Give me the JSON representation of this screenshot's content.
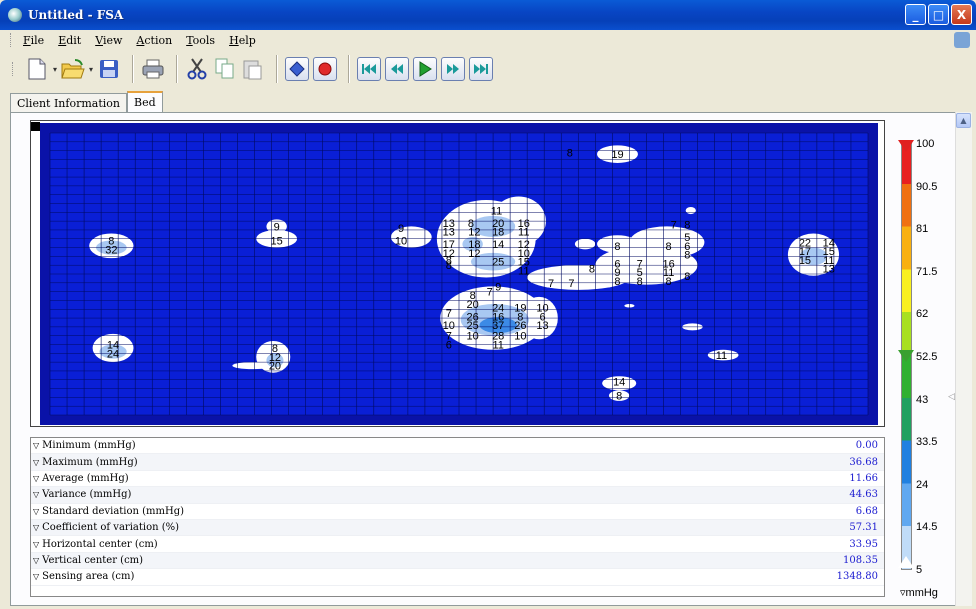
{
  "window": {
    "title": "Untitled - FSA",
    "icon": "app-icon",
    "buttons": {
      "minimize": "_",
      "maximize": "□",
      "close": "X"
    }
  },
  "menu": {
    "items": [
      {
        "label": "File",
        "accel": "F"
      },
      {
        "label": "Edit",
        "accel": "E"
      },
      {
        "label": "View",
        "accel": "V"
      },
      {
        "label": "Action",
        "accel": "A"
      },
      {
        "label": "Tools",
        "accel": "T"
      },
      {
        "label": "Help",
        "accel": "H"
      }
    ]
  },
  "toolbar": {
    "buttons": [
      "new-icon",
      "open-icon",
      "save-icon",
      "print-icon",
      "cut-icon",
      "copy-icon",
      "paste-icon",
      "stop-icon",
      "record-icon",
      "first-frame-icon",
      "previous-frame-icon",
      "play-icon",
      "next-frame-icon",
      "last-frame-icon"
    ]
  },
  "tabs": [
    {
      "label": "Client Information",
      "active": false
    },
    {
      "label": "Bed",
      "active": true
    }
  ],
  "pressure_map": {
    "colors": {
      "background": "#0a1fd6",
      "frame": "#0a12a8",
      "low": "#ffffff",
      "mid": "#a8c8f2",
      "high": "#3c8ae6"
    },
    "rows": 16,
    "cols": 48,
    "labels": [
      {
        "text": "19",
        "r": 1.2,
        "c": 33.3
      },
      {
        "text": "8",
        "r": 1.1,
        "c": 30.5
      },
      {
        "text": "11",
        "r": 4.4,
        "c": 26.2
      },
      {
        "text": "13",
        "r": 5.1,
        "c": 23.4
      },
      {
        "text": "8",
        "r": 5.1,
        "c": 24.7
      },
      {
        "text": "20",
        "r": 5.1,
        "c": 26.3
      },
      {
        "text": "16",
        "r": 5.1,
        "c": 27.8
      },
      {
        "text": "13",
        "r": 5.6,
        "c": 23.4
      },
      {
        "text": "12",
        "r": 5.6,
        "c": 24.9
      },
      {
        "text": "18",
        "r": 5.6,
        "c": 26.3
      },
      {
        "text": "11",
        "r": 5.6,
        "c": 27.8
      },
      {
        "text": "9",
        "r": 5.4,
        "c": 20.6
      },
      {
        "text": "10",
        "r": 6.1,
        "c": 20.6
      },
      {
        "text": "17",
        "r": 6.3,
        "c": 23.4
      },
      {
        "text": "18",
        "r": 6.3,
        "c": 24.9
      },
      {
        "text": "14",
        "r": 6.3,
        "c": 26.3
      },
      {
        "text": "12",
        "r": 6.3,
        "c": 27.8
      },
      {
        "text": "12",
        "r": 6.8,
        "c": 23.4
      },
      {
        "text": "12",
        "r": 6.8,
        "c": 24.9
      },
      {
        "text": "10",
        "r": 6.8,
        "c": 27.8
      },
      {
        "text": "8",
        "r": 7.2,
        "c": 23.4
      },
      {
        "text": "8",
        "r": 7.5,
        "c": 23.4
      },
      {
        "text": "25",
        "r": 7.3,
        "c": 26.3
      },
      {
        "text": "15",
        "r": 7.3,
        "c": 27.8
      },
      {
        "text": "11",
        "r": 7.8,
        "c": 27.8
      },
      {
        "text": "7",
        "r": 5.2,
        "c": 36.6
      },
      {
        "text": "8",
        "r": 5.2,
        "c": 37.4
      },
      {
        "text": "8",
        "r": 6.4,
        "c": 33.3
      },
      {
        "text": "5",
        "r": 5.9,
        "c": 37.4
      },
      {
        "text": "6",
        "r": 6.4,
        "c": 37.4
      },
      {
        "text": "8",
        "r": 6.4,
        "c": 36.3
      },
      {
        "text": "8",
        "r": 6.9,
        "c": 37.4
      },
      {
        "text": "6",
        "r": 7.4,
        "c": 33.3
      },
      {
        "text": "7",
        "r": 7.4,
        "c": 34.6
      },
      {
        "text": "16",
        "r": 7.4,
        "c": 36.3
      },
      {
        "text": "8",
        "r": 7.7,
        "c": 31.8
      },
      {
        "text": "9",
        "r": 7.9,
        "c": 33.3
      },
      {
        "text": "5",
        "r": 7.9,
        "c": 34.6
      },
      {
        "text": "11",
        "r": 7.9,
        "c": 36.3
      },
      {
        "text": "8",
        "r": 8.4,
        "c": 33.3
      },
      {
        "text": "8",
        "r": 8.4,
        "c": 34.6
      },
      {
        "text": "8",
        "r": 8.4,
        "c": 36.3
      },
      {
        "text": "8",
        "r": 8.1,
        "c": 37.4
      },
      {
        "text": "7",
        "r": 8.5,
        "c": 29.4
      },
      {
        "text": "7",
        "r": 8.5,
        "c": 30.6
      },
      {
        "text": "9",
        "r": 8.7,
        "c": 26.3
      },
      {
        "text": "22",
        "r": 6.2,
        "c": 44.3
      },
      {
        "text": "14",
        "r": 6.2,
        "c": 45.7
      },
      {
        "text": "17",
        "r": 6.7,
        "c": 44.3
      },
      {
        "text": "15",
        "r": 6.7,
        "c": 45.7
      },
      {
        "text": "15",
        "r": 7.2,
        "c": 44.3
      },
      {
        "text": "11",
        "r": 7.2,
        "c": 45.7
      },
      {
        "text": "13",
        "r": 7.7,
        "c": 45.7
      },
      {
        "text": "8",
        "r": 6.1,
        "c": 3.6
      },
      {
        "text": "32",
        "r": 6.6,
        "c": 3.6
      },
      {
        "text": "9",
        "r": 5.3,
        "c": 13.3
      },
      {
        "text": "15",
        "r": 6.1,
        "c": 13.3
      },
      {
        "text": "8",
        "r": 9.2,
        "c": 24.8
      },
      {
        "text": "7",
        "r": 9.0,
        "c": 25.8
      },
      {
        "text": "20",
        "r": 9.7,
        "c": 24.8
      },
      {
        "text": "24",
        "r": 9.9,
        "c": 26.3
      },
      {
        "text": "19",
        "r": 9.9,
        "c": 27.6
      },
      {
        "text": "10",
        "r": 9.9,
        "c": 28.9
      },
      {
        "text": "7",
        "r": 10.2,
        "c": 23.4
      },
      {
        "text": "26",
        "r": 10.4,
        "c": 24.8
      },
      {
        "text": "16",
        "r": 10.4,
        "c": 26.3
      },
      {
        "text": "8",
        "r": 10.4,
        "c": 27.6
      },
      {
        "text": "6",
        "r": 10.4,
        "c": 28.9
      },
      {
        "text": "10",
        "r": 10.9,
        "c": 23.4
      },
      {
        "text": "25",
        "r": 10.9,
        "c": 24.8
      },
      {
        "text": "37",
        "r": 10.9,
        "c": 26.3
      },
      {
        "text": "26",
        "r": 10.9,
        "c": 27.6
      },
      {
        "text": "13",
        "r": 10.9,
        "c": 28.9
      },
      {
        "text": "7",
        "r": 11.5,
        "c": 23.4
      },
      {
        "text": "10",
        "r": 11.5,
        "c": 24.8
      },
      {
        "text": "28",
        "r": 11.5,
        "c": 26.3
      },
      {
        "text": "10",
        "r": 11.5,
        "c": 27.6
      },
      {
        "text": "6",
        "r": 12.0,
        "c": 23.4
      },
      {
        "text": "11",
        "r": 12.0,
        "c": 26.3
      },
      {
        "text": "14",
        "r": 12.0,
        "c": 3.7
      },
      {
        "text": "24",
        "r": 12.5,
        "c": 3.7
      },
      {
        "text": "8",
        "r": 12.2,
        "c": 13.2
      },
      {
        "text": "12",
        "r": 12.7,
        "c": 13.2
      },
      {
        "text": "20",
        "r": 13.2,
        "c": 13.2
      },
      {
        "text": "11",
        "r": 12.6,
        "c": 39.4
      },
      {
        "text": "14",
        "r": 14.1,
        "c": 33.4
      },
      {
        "text": "8",
        "r": 14.9,
        "c": 33.4
      }
    ]
  },
  "stats": [
    {
      "label": "Minimum (mmHg)",
      "value": "0.00"
    },
    {
      "label": "Maximum (mmHg)",
      "value": "36.68"
    },
    {
      "label": "Average (mmHg)",
      "value": "11.66"
    },
    {
      "label": "Variance (mmHg)",
      "value": "44.63"
    },
    {
      "label": "Standard deviation (mmHg)",
      "value": "6.68"
    },
    {
      "label": "Coefficient of variation (%)",
      "value": "57.31"
    },
    {
      "label": "Horizontal center (cm)",
      "value": "33.95"
    },
    {
      "label": "Vertical center (cm)",
      "value": "108.35"
    },
    {
      "label": "Sensing area (cm)",
      "value": "1348.80"
    }
  ],
  "legend": {
    "ticks": [
      "100",
      "90.5",
      "81",
      "71.5",
      "62",
      "52.5",
      "43",
      "33.5",
      "24",
      "14.5",
      "5"
    ],
    "unit": "mmHg",
    "colors": [
      "#e82020",
      "#f07010",
      "#f8b010",
      "#f8f020",
      "#a8e020",
      "#30b030",
      "#20a060",
      "#2080e0",
      "#60a8f0",
      "#c0dcf8",
      "#ffffff"
    ]
  }
}
